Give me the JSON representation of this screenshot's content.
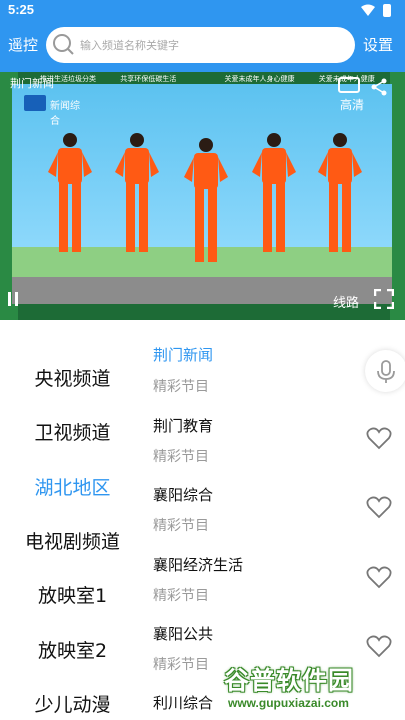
{
  "status_bar": {
    "time": "5:25"
  },
  "header": {
    "left_label": "遥控",
    "right_label": "设置",
    "search_placeholder": "输入频道名称关键字"
  },
  "player": {
    "channel_name": "荆门新闻",
    "ticker": [
      "推进生活垃圾分类",
      "共享环保低碳生活",
      "关爱未成年人身心健康",
      "关爱未成年人健康"
    ],
    "station_logo_text": "新闻综合",
    "quality_label": "高清",
    "route_label": "线路"
  },
  "categories": [
    {
      "label": "央视频道",
      "active": false
    },
    {
      "label": "卫视频道",
      "active": false
    },
    {
      "label": "湖北地区",
      "active": true
    },
    {
      "label": "电视剧频道",
      "active": false
    },
    {
      "label": "放映室1",
      "active": false
    },
    {
      "label": "放映室2",
      "active": false
    },
    {
      "label": "少儿动漫",
      "active": false
    }
  ],
  "channels": [
    {
      "name": "荆门新闻",
      "subtitle": "精彩节目",
      "active": true
    },
    {
      "name": "荆门教育",
      "subtitle": "精彩节目",
      "active": false
    },
    {
      "name": "襄阳综合",
      "subtitle": "精彩节目",
      "active": false
    },
    {
      "name": "襄阳经济生活",
      "subtitle": "精彩节目",
      "active": false
    },
    {
      "name": "襄阳公共",
      "subtitle": "精彩节目",
      "active": false
    },
    {
      "name": "利川综合",
      "subtitle": "",
      "active": false
    }
  ],
  "watermark": {
    "brand": "谷普软件园",
    "url": "www.gupuxiazai.com"
  },
  "colors": {
    "accent": "#2f96f0",
    "subtitle": "#9a9a9a",
    "text": "#111111",
    "watermark": "#3a8a2a"
  },
  "icons": [
    "search-icon",
    "wifi-icon",
    "battery-icon",
    "tv-icon",
    "share-icon",
    "pause-icon",
    "fullscreen-icon",
    "mic-icon",
    "heart-icon"
  ]
}
